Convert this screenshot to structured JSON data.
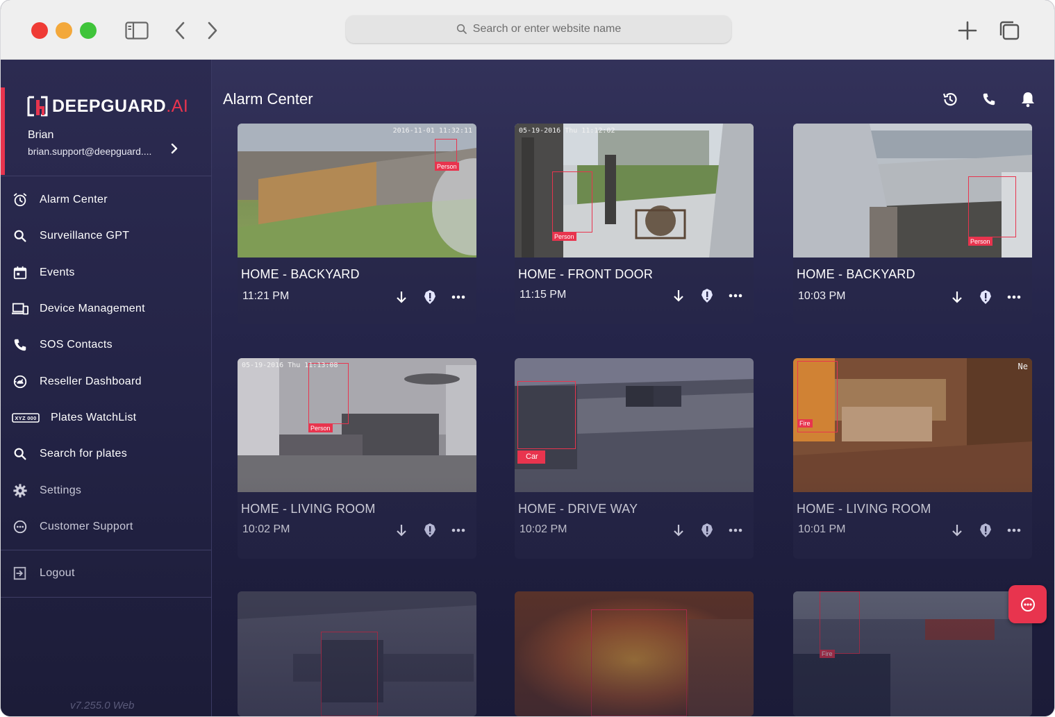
{
  "browser": {
    "url_placeholder": "Search or enter website name"
  },
  "brand": {
    "name": "DEEPGUARD",
    "suffix": ".AI",
    "accent_color": "#e8344e"
  },
  "user": {
    "name": "Brian",
    "email": "brian.support@deepguard...."
  },
  "nav": {
    "items": [
      {
        "label": "Alarm Center",
        "icon": "alarm-clock-icon"
      },
      {
        "label": "Surveillance GPT",
        "icon": "search-icon"
      },
      {
        "label": "Events",
        "icon": "calendar-icon"
      },
      {
        "label": "Device Management",
        "icon": "devices-icon"
      },
      {
        "label": "SOS Contacts",
        "icon": "phone-icon"
      },
      {
        "label": "Reseller Dashboard",
        "icon": "dashboard-icon"
      },
      {
        "label": "Plates WatchList",
        "icon": "license-plate-icon"
      },
      {
        "label": "Search for plates",
        "icon": "search-icon"
      },
      {
        "label": "Settings",
        "icon": "gear-icon"
      },
      {
        "label": "Customer Support",
        "icon": "support-icon"
      }
    ],
    "logout_label": "Logout",
    "plate_badge": "XYZ 000"
  },
  "version": "v7.255.0 Web",
  "page": {
    "title": "Alarm Center"
  },
  "cards": [
    {
      "title": "HOME - BACKYARD",
      "time": "11:21 PM",
      "stamp": "2016-11-01 11:32:11",
      "label": "Person"
    },
    {
      "title": "HOME - FRONT DOOR",
      "time": "11:15 PM",
      "stamp": "05-19-2016 Thu 11:12:02",
      "label": "Person"
    },
    {
      "title": "HOME - BACKYARD",
      "time": "10:03 PM",
      "stamp": "",
      "label": "Person"
    },
    {
      "title": "HOME - LIVING ROOM",
      "time": "10:02 PM",
      "stamp": "05-19-2016 Thu 11:13:08",
      "label": "Person"
    },
    {
      "title": "HOME - DRIVE WAY",
      "time": "10:02 PM",
      "stamp": "",
      "label": "Car"
    },
    {
      "title": "HOME - LIVING ROOM",
      "time": "10:01 PM",
      "stamp": "Ne",
      "label": "Fire"
    },
    {
      "title": "",
      "time": "",
      "stamp": "",
      "label": ""
    },
    {
      "title": "",
      "time": "",
      "stamp": "",
      "label": ""
    },
    {
      "title": "",
      "time": "",
      "stamp": "",
      "label": "Fire"
    }
  ]
}
